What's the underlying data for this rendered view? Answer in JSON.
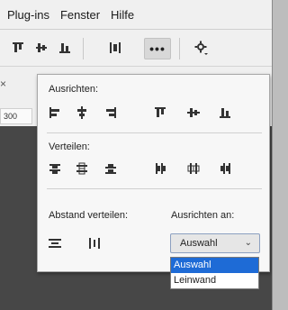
{
  "menu": [
    "Plug-ins",
    "Fenster",
    "Hilfe"
  ],
  "toolbar": {
    "more_label": "•••"
  },
  "ruler_value": "300",
  "behind_close": "×",
  "panel": {
    "section_align": "Ausrichten:",
    "section_distribute": "Verteilen:",
    "section_spacing": "Abstand verteilen:",
    "section_align_to": "Ausrichten an:",
    "align_to_value": "Auswahl",
    "options": [
      "Auswahl",
      "Leinwand"
    ]
  },
  "colors": {
    "accent": "#1e6bd6",
    "canvas": "#474747"
  }
}
